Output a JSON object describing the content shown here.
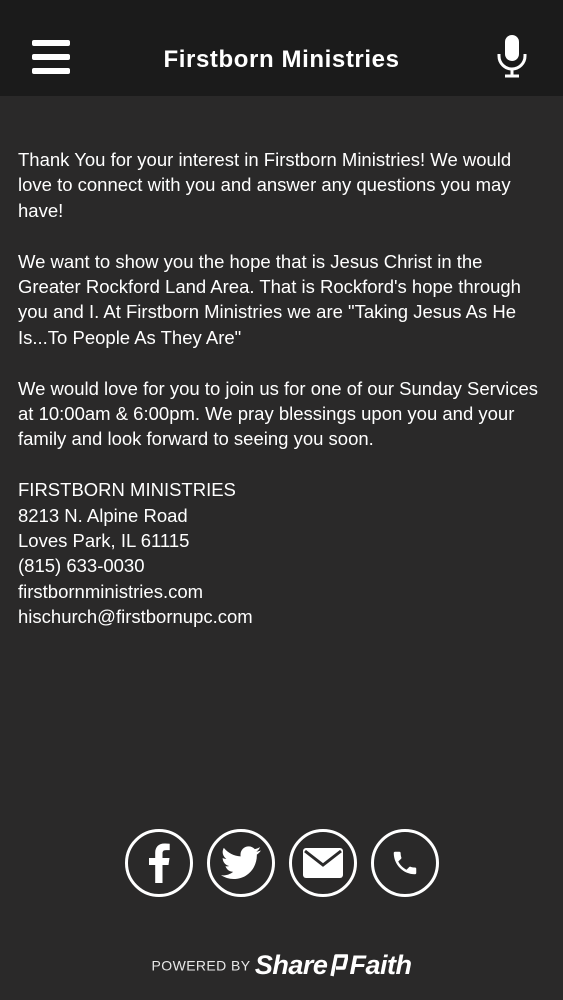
{
  "header": {
    "title": "Firstborn Ministries",
    "menu_icon": "hamburger-menu-icon",
    "mic_icon": "microphone-icon"
  },
  "content": {
    "paragraphs": [
      "Thank You for your interest in Firstborn Ministries!  We would love to connect with you and answer any questions you may have!",
      "We want to show you the hope that is  Jesus Christ in the Greater Rockford Land Area.  That is Rockford's hope through you and I.  At Firstborn Ministries we are \"Taking Jesus As He Is...To People As They Are\"",
      "We would love for you to join us for one of our Sunday Services at 10:00am & 6:00pm.  We pray blessings upon you and your family and look forward to seeing you soon."
    ],
    "address": {
      "name": "FIRSTBORN MINISTRIES",
      "street": "8213 N. Alpine Road",
      "city": "Loves Park, IL 61115",
      "phone": "(815) 633-0030",
      "website": "firstbornministries.com",
      "email": "hischurch@firstbornupc.com"
    }
  },
  "social": [
    {
      "icon": "facebook-icon"
    },
    {
      "icon": "twitter-icon"
    },
    {
      "icon": "email-icon"
    },
    {
      "icon": "phone-icon"
    }
  ],
  "footer": {
    "powered_by": "POWERED BY",
    "brand_left": "Share",
    "brand_right": "Faith"
  },
  "colors": {
    "background": "#2a2929",
    "header_background": "#1b1b1b",
    "text": "#ffffff"
  }
}
